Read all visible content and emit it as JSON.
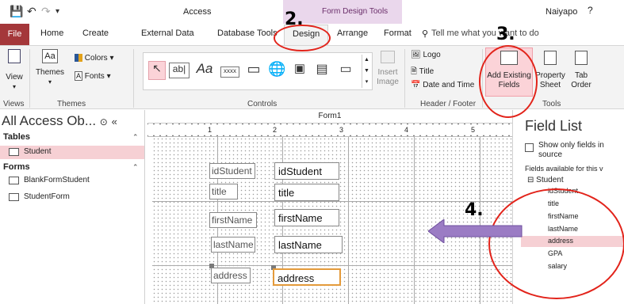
{
  "titlebar": {
    "app_title": "Access",
    "context_title": "Form Design Tools",
    "user": "Naiyapo",
    "help": "?"
  },
  "tabs": [
    "File",
    "Home",
    "Create",
    "External Data",
    "Database Tools",
    "Design",
    "Arrange",
    "Format"
  ],
  "active_tab": "Design",
  "tell_me": "Tell me what you want to do",
  "ribbon": {
    "views": {
      "view_label": "View",
      "group": "Views"
    },
    "themes": {
      "themes_label": "Themes",
      "colors_label": "Colors",
      "fonts_label": "Fonts",
      "group": "Themes"
    },
    "controls": {
      "group": "Controls",
      "insert_image_label": "Insert Image",
      "text_aa": "Aa",
      "text_abl": "ab|"
    },
    "header_footer": {
      "logo_label": "Logo",
      "title_label": "Title",
      "date_time_label": "Date and Time",
      "group": "Header / Footer"
    },
    "tools": {
      "add_existing_fields_label": "Add Existing Fields",
      "property_sheet_label": "Property Sheet",
      "tab_order_label": "Tab Order",
      "group": "Tools"
    }
  },
  "nav_pane": {
    "title": "All Access Ob...",
    "sections": [
      {
        "name": "Tables",
        "items": [
          {
            "label": "Student",
            "selected": true
          }
        ]
      },
      {
        "name": "Forms",
        "items": [
          {
            "label": "BlankFormStudent",
            "selected": false
          },
          {
            "label": "StudentForm",
            "selected": false
          }
        ]
      }
    ]
  },
  "form": {
    "tab_title": "Form1",
    "ruler_numbers": [
      "1",
      "2",
      "3",
      "4",
      "5"
    ],
    "rows": [
      {
        "label": "idStudent",
        "field": "idStudent"
      },
      {
        "label": "title",
        "field": "title"
      },
      {
        "label": "firstName",
        "field": "firstName"
      },
      {
        "label": "lastName",
        "field": "lastName"
      },
      {
        "label": "address",
        "field": "address"
      }
    ]
  },
  "field_list": {
    "title": "Field List",
    "show_only": "Show only fields in source",
    "available": "Fields available for this v",
    "table": "Student",
    "fields": [
      "idStudent",
      "title",
      "firstName",
      "lastName",
      "address",
      "GPA",
      "salary"
    ],
    "selected_field": "address"
  },
  "annotations": {
    "step2": "2.",
    "step3": "3.",
    "step4": "4."
  },
  "colors": {
    "file_tab": "#a4373a",
    "context_band": "#ead7ec",
    "selection_pink": "#f6d0d4",
    "annotation_red": "#e2231a",
    "arrow_purple": "#9b7cc4"
  }
}
